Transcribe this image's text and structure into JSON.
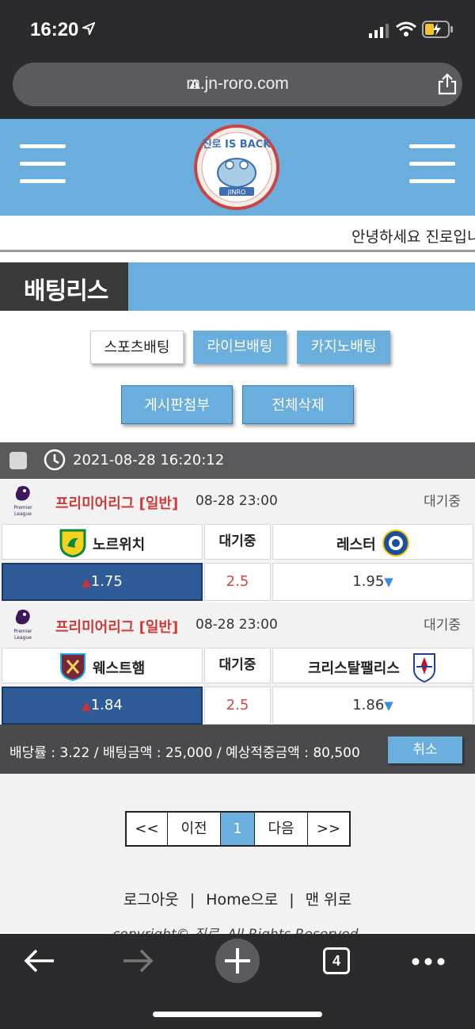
{
  "status_bar": {
    "time": "16:20"
  },
  "browser": {
    "url": "m.jn-roro.com",
    "tab_count": "4"
  },
  "header": {
    "logo_text": "진로 IS BACK",
    "logo_sub": "JINRO"
  },
  "marquee": {
    "text": "안녕하세요 진로입니"
  },
  "page": {
    "title": "배팅리스"
  },
  "tabs": [
    {
      "label": "스포츠배팅",
      "active": true
    },
    {
      "label": "라이브배팅",
      "active": false
    },
    {
      "label": "카지노배팅",
      "active": false
    }
  ],
  "actions": {
    "attach_label": "게시판첨부",
    "delete_all_label": "전체삭제"
  },
  "bet_list": {
    "datetime": "2021-08-28 16:20:12",
    "matches": [
      {
        "league": "프리미어리그 [일반]",
        "time": "08-28 23:00",
        "status": "대기중",
        "home_team": "노르위치",
        "mid_label": "대기중",
        "away_team": "레스터",
        "home_odds": "1.75",
        "draw_odds": "2.5",
        "away_odds": "1.95"
      },
      {
        "league": "프리미어리그 [일반]",
        "time": "08-28 23:00",
        "status": "대기중",
        "home_team": "웨스트햄",
        "mid_label": "대기중",
        "away_team": "크리스탈팰리스",
        "home_odds": "1.84",
        "draw_odds": "2.5",
        "away_odds": "1.86"
      }
    ]
  },
  "summary": {
    "text": "배당률 : 3.22 / 배팅금액 : 25,000 / 예상적중금액 : 80,500",
    "cancel_label": "취소"
  },
  "pagination": {
    "first": "<<",
    "prev": "이전",
    "current": "1",
    "next": "다음",
    "last": ">>"
  },
  "footer": {
    "logout": "로그아웃",
    "home": "Home으로",
    "top": "맨 위로",
    "sep": "|",
    "copyright": "copyright© 진로. All Rights Reserved."
  },
  "colors": {
    "accent": "#6aaede",
    "dark": "#3a3a3a",
    "selected_odds": "#2f5b99",
    "league_red": "#cc3a3a"
  }
}
